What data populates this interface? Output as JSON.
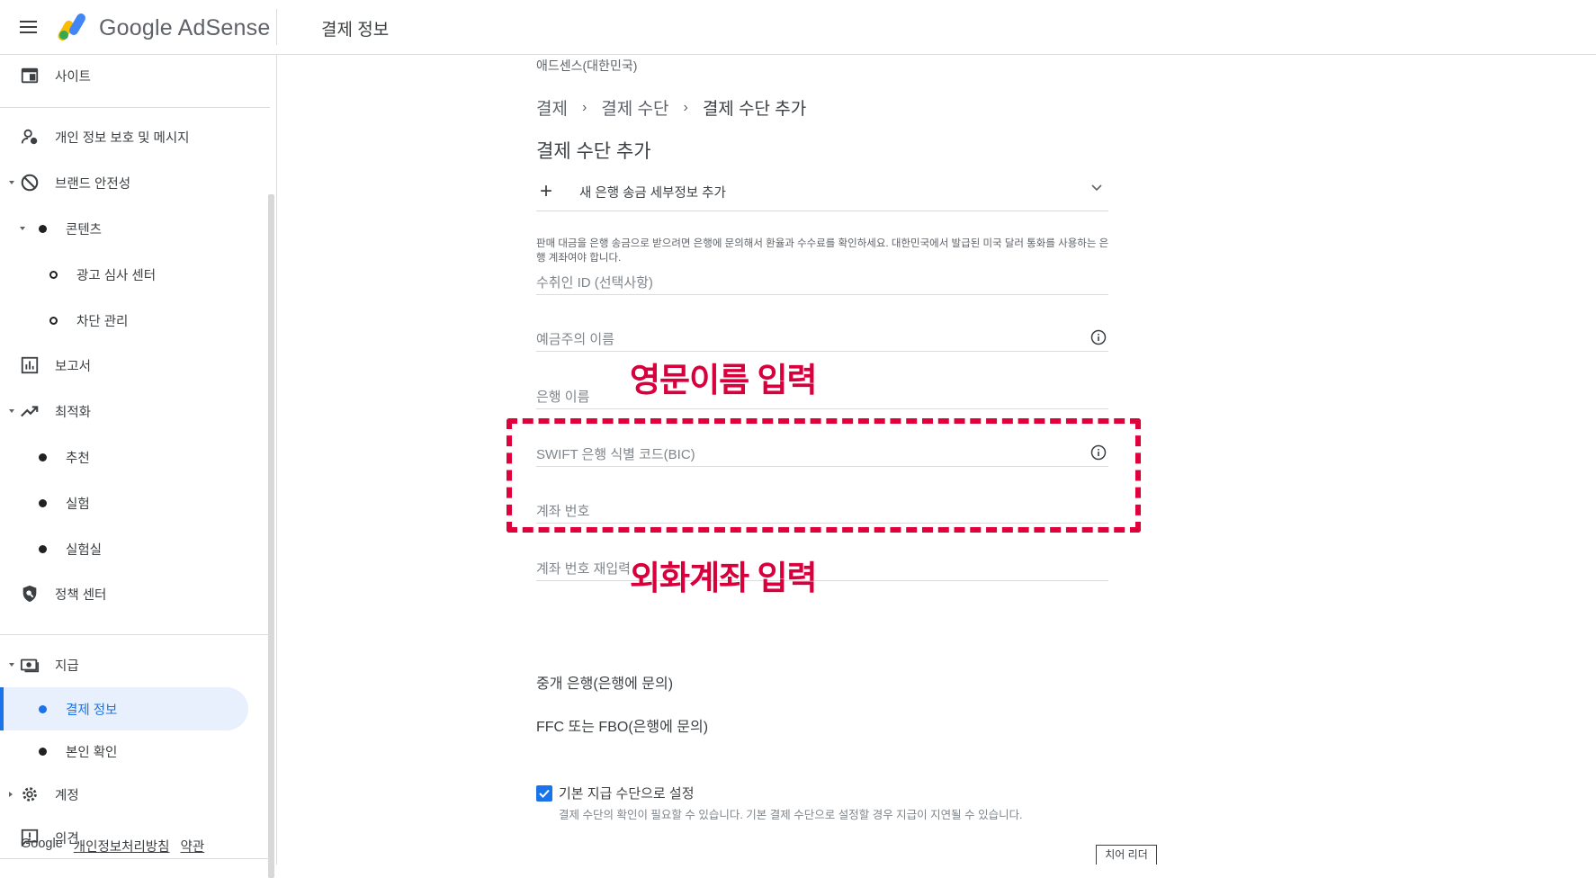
{
  "header": {
    "brand": "Google AdSense",
    "page_title": "결제 정보"
  },
  "sidebar": {
    "items": [
      {
        "label": "사이트",
        "icon": "web-icon"
      },
      {
        "label": "개인 정보 보호 및 메시지",
        "icon": "person-privacy-icon"
      },
      {
        "label": "브랜드 안전성",
        "icon": "block-icon"
      },
      {
        "label": "콘텐츠"
      },
      {
        "label": "광고 심사 센터"
      },
      {
        "label": "차단 관리"
      },
      {
        "label": "보고서",
        "icon": "bar-chart-icon"
      },
      {
        "label": "최적화",
        "icon": "trending-up-icon"
      },
      {
        "label": "추천"
      },
      {
        "label": "실험"
      },
      {
        "label": "실험실"
      },
      {
        "label": "정책 센터",
        "icon": "policy-shield-icon"
      },
      {
        "label": "지급",
        "icon": "payments-icon"
      },
      {
        "label": "결제 정보"
      },
      {
        "label": "본인 확인"
      },
      {
        "label": "계정",
        "icon": "gear-icon"
      },
      {
        "label": "의견",
        "icon": "feedback-icon"
      }
    ],
    "footer": {
      "google": "Google",
      "privacy": "개인정보처리방침",
      "terms": "약관"
    }
  },
  "main": {
    "account": "애드센스(대한민국)",
    "breadcrumb": [
      "결제",
      "결제 수단",
      "결제 수단 추가"
    ],
    "title": "결제 수단 추가",
    "expander": "새 은행 송금 세부정보 추가",
    "note": "판매 대금을 은행 송금으로 받으려면 은행에 문의해서 환율과 수수료를 확인하세요. 대한민국에서 발급된 미국 달러 통화를 사용하는 은행 계좌여야 합니다.",
    "fields": {
      "payee_id": "수취인 ID (선택사항)",
      "holder_name": "예금주의 이름",
      "bank_name": "은행 이름",
      "swift": "SWIFT 은행 식별 코드(BIC)",
      "account_number": "계좌 번호",
      "account_number_confirm": "계좌 번호 재입력"
    },
    "intermediary": "중개 은행(은행에 문의)",
    "ffc": "FFC 또는 FBO(은행에 문의)",
    "default_checkbox": {
      "checked": true,
      "title": "기본 지급 수단으로 설정",
      "sub": "결제 수단의 확인이 필요할 수 있습니다. 기본 결제 수단으로 설정할 경우 지급이 지연될 수 있습니다."
    },
    "reader_button": "치어 리더"
  },
  "annotations": {
    "name_hint": "영문이름 입력",
    "account_hint": "외화계좌 입력",
    "color": "#e0003c"
  },
  "colors": {
    "accent": "#1a73e8",
    "active_bg": "#e8f0fe"
  }
}
